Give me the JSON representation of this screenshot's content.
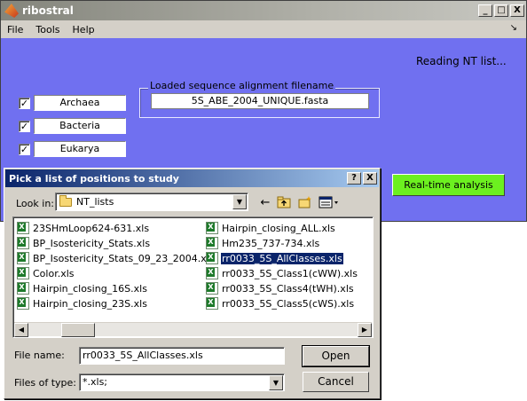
{
  "main_window": {
    "title": "ribostral",
    "buttons": {
      "minimize": "_",
      "maximize": "□",
      "close": "X"
    },
    "menu": [
      "File",
      "Tools",
      "Help"
    ],
    "status": "Reading NT list...",
    "checkboxes": [
      {
        "label": "Archaea",
        "checked": true
      },
      {
        "label": "Bacteria",
        "checked": true
      },
      {
        "label": "Eukarya",
        "checked": true
      }
    ],
    "filename_group_label": "Loaded sequence alignment filename",
    "filename_value": "5S_ABE_2004_UNIQUE.fasta",
    "realtime_button": "Real-time analysis"
  },
  "dialog": {
    "title": "Pick a list of positions to study",
    "lookin_label": "Look in:",
    "lookin_value": "NT_lists",
    "files_left": [
      "23SHmLoop624-631.xls",
      "BP_Isostericity_Stats.xls",
      "BP_Isostericity_Stats_09_23_2004.xls",
      "Color.xls",
      "Hairpin_closing_16S.xls",
      "Hairpin_closing_23S.xls"
    ],
    "files_right": [
      "Hairpin_closing_ALL.xls",
      "Hm235_737-734.xls",
      "rr0033_5S_AllClasses.xls",
      "rr0033_5S_Class1(cWW).xls",
      "rr0033_5S_Class4(tWH).xls",
      "rr0033_5S_Class5(cWS).xls"
    ],
    "selected_file": "rr0033_5S_AllClasses.xls",
    "filename_label": "File name:",
    "filename_value": "rr0033_5S_AllClasses.xls",
    "filetype_label": "Files of type:",
    "filetype_value": "*.xls;",
    "open_button": "Open",
    "cancel_button": "Cancel"
  }
}
